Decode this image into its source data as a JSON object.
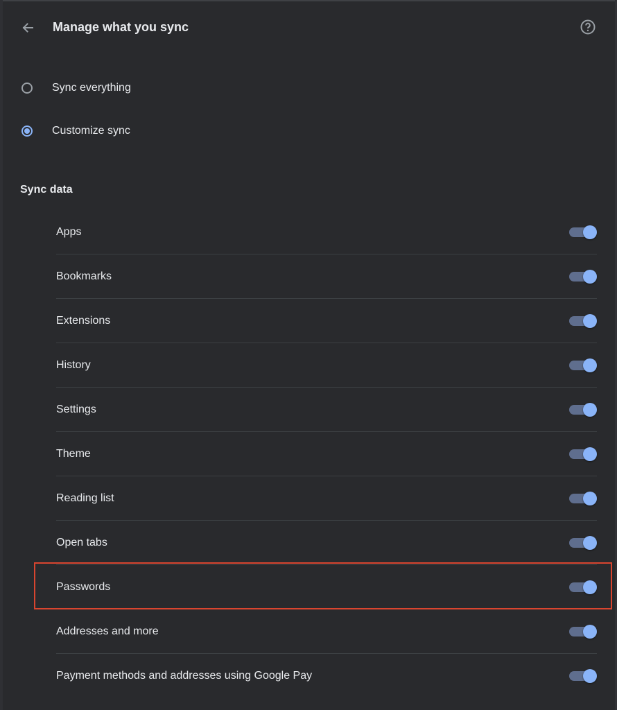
{
  "header": {
    "title": "Manage what you sync",
    "back_icon": "arrow-left-icon",
    "help_icon": "help-circle-icon"
  },
  "sync_mode": {
    "options": [
      {
        "label": "Sync everything",
        "selected": false
      },
      {
        "label": "Customize sync",
        "selected": true
      }
    ]
  },
  "sync_data": {
    "title": "Sync data",
    "items": [
      {
        "label": "Apps",
        "enabled": true
      },
      {
        "label": "Bookmarks",
        "enabled": true
      },
      {
        "label": "Extensions",
        "enabled": true
      },
      {
        "label": "History",
        "enabled": true
      },
      {
        "label": "Settings",
        "enabled": true
      },
      {
        "label": "Theme",
        "enabled": true
      },
      {
        "label": "Reading list",
        "enabled": true
      },
      {
        "label": "Open tabs",
        "enabled": true
      },
      {
        "label": "Passwords",
        "enabled": true,
        "highlighted": true
      },
      {
        "label": "Addresses and more",
        "enabled": true
      },
      {
        "label": "Payment methods and addresses using Google Pay",
        "enabled": true
      }
    ]
  },
  "colors": {
    "background": "#292a2d",
    "accent": "#8ab4f8",
    "toggle_track": "#5f6e8e",
    "highlight": "#d9452f"
  }
}
